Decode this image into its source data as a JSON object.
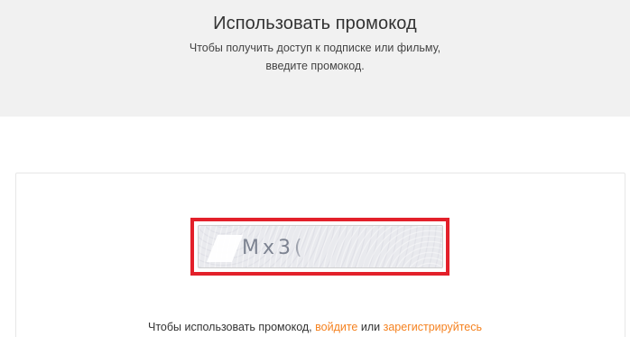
{
  "hero": {
    "title": "Использовать промокод",
    "subtitle_line1": "Чтобы получить доступ к подписке или фильму,",
    "subtitle_line2": "введите промокод."
  },
  "promo": {
    "code_value": "Mx3("
  },
  "footer_note": {
    "prefix": "Чтобы использовать промокод, ",
    "login_link": "войдите",
    "middle": " или ",
    "register_link": "зарегистрируйтесь"
  },
  "colors": {
    "hero_background": "#f1f1f1",
    "highlight_border": "#e3202a",
    "link": "#f58220"
  }
}
